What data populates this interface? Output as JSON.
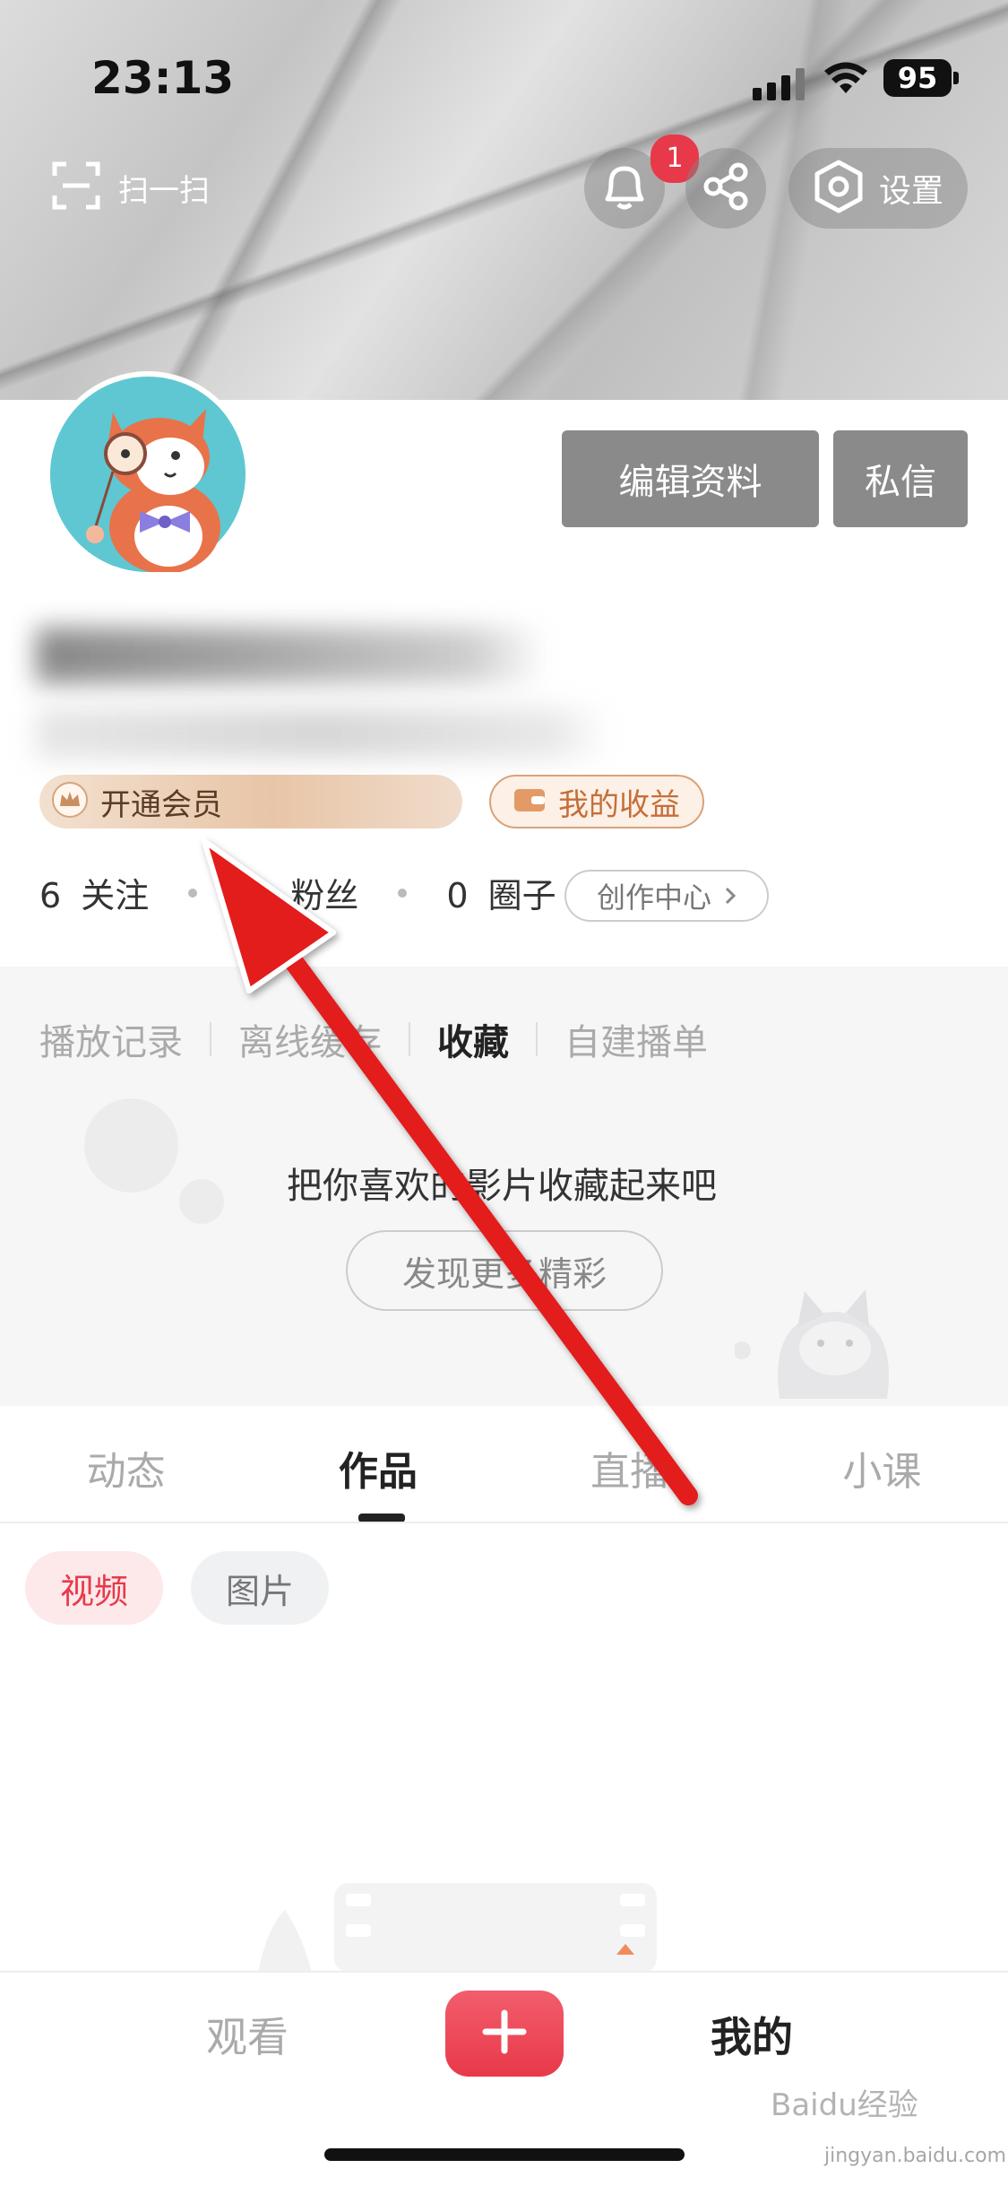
{
  "status_bar": {
    "time": "23:13",
    "battery": "95"
  },
  "header": {
    "scan_label": "扫一扫",
    "notification_count": "1",
    "settings_label": "设置"
  },
  "profile": {
    "edit_label": "编辑资料",
    "message_label": "私信",
    "vip_label": "开通会员",
    "earnings_label": "我的收益",
    "following_count": "6",
    "following_label": "关注",
    "fans_label": "粉丝",
    "circles_count": "0",
    "circles_label": "圈子",
    "creator_center_label": "创作中心"
  },
  "collection": {
    "tabs": [
      {
        "label": "播放记录"
      },
      {
        "label": "离线缓存"
      },
      {
        "label": "收藏"
      },
      {
        "label": "自建播单"
      }
    ],
    "empty_message": "把你喜欢的影片收藏起来吧",
    "discover_label": "发现更多精彩"
  },
  "main_tabs": [
    {
      "label": "动态"
    },
    {
      "label": "作品"
    },
    {
      "label": "直播"
    },
    {
      "label": "小课"
    }
  ],
  "filters": {
    "video": "视频",
    "photo": "图片"
  },
  "bottom_nav": {
    "watch": "观看",
    "mine": "我的"
  },
  "watermark": {
    "brand": "Baidu经验",
    "url": "jingyan.baidu.com"
  },
  "colors": {
    "accent": "#e8394a",
    "vip_gold": "#e8c5a7",
    "earnings_orange": "#c46f3a",
    "annotation_red": "#e31b1b"
  },
  "icons": [
    "scan-icon",
    "bell-icon",
    "share-icon",
    "settings-hex-icon",
    "crown-icon",
    "wallet-icon",
    "chevron-right-icon",
    "plus-icon"
  ]
}
